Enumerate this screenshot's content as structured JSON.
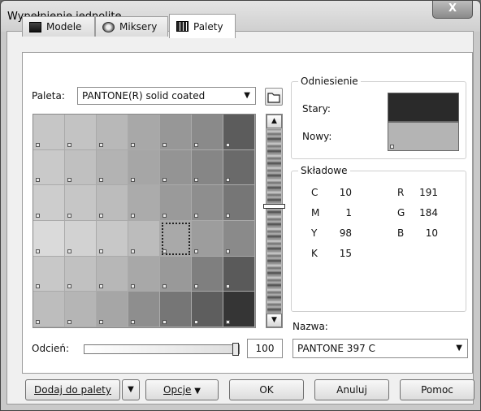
{
  "window": {
    "title": "Wypełnienie jednolite",
    "close_label": "X"
  },
  "tabs": [
    {
      "label": "Modele",
      "icon": "square-icon",
      "active": false
    },
    {
      "label": "Miksery",
      "icon": "mixer-icon",
      "active": false
    },
    {
      "label": "Palety",
      "icon": "palette-icon",
      "active": true
    }
  ],
  "palette": {
    "label": "Paleta:",
    "value": "PANTONE(R) solid coated"
  },
  "reference": {
    "title": "Odniesienie",
    "old_label": "Stary:",
    "new_label": "Nowy:",
    "old_color": "#2a2a2a",
    "new_color": "#b4b4b4"
  },
  "components": {
    "title": "Składowe",
    "cmyk": [
      {
        "key": "C",
        "value": "10"
      },
      {
        "key": "M",
        "value": "1"
      },
      {
        "key": "Y",
        "value": "98"
      },
      {
        "key": "K",
        "value": "15"
      }
    ],
    "rgb": [
      {
        "key": "R",
        "value": "191"
      },
      {
        "key": "G",
        "value": "184"
      },
      {
        "key": "B",
        "value": "10"
      }
    ]
  },
  "name": {
    "label": "Nazwa:",
    "value": "PANTONE 397 C"
  },
  "tint": {
    "label": "Odcień:",
    "value": "100"
  },
  "grid_rows": [
    [
      "#c6c6c6",
      "#c3c3c3",
      "#b8b8b8",
      "#a8a8a8",
      "#979797",
      "#8a8a8a",
      "#5c5c5c"
    ],
    [
      "#c9c9c9",
      "#c0c0c0",
      "#b3b3b3",
      "#a6a6a6",
      "#949494",
      "#868686",
      "#6a6a6a"
    ],
    [
      "#cdcdcd",
      "#c6c6c6",
      "#bcbcbc",
      "#ababab",
      "#9a9a9a",
      "#8e8e8e",
      "#767676"
    ],
    [
      "#dadada",
      "#d2d2d2",
      "#c8c8c8",
      "#bcbcbc",
      "#a9a9a9",
      "#9d9d9d",
      "#8a8a8a"
    ],
    [
      "#c8c8c8",
      "#c1c1c1",
      "#b7b7b7",
      "#a8a8a8",
      "#999999",
      "#7f7f7f",
      "#5a5a5a"
    ],
    [
      "#bdbdbd",
      "#b5b5b5",
      "#a6a6a6",
      "#8e8e8e",
      "#767676",
      "#5e5e5e",
      "#353535"
    ]
  ],
  "selected_cell": {
    "row": 3,
    "col": 4
  },
  "buttons": {
    "add_to_palette": "Dodaj do palety",
    "options": "Opcje",
    "ok": "OK",
    "cancel": "Anuluj",
    "help": "Pomoc"
  }
}
